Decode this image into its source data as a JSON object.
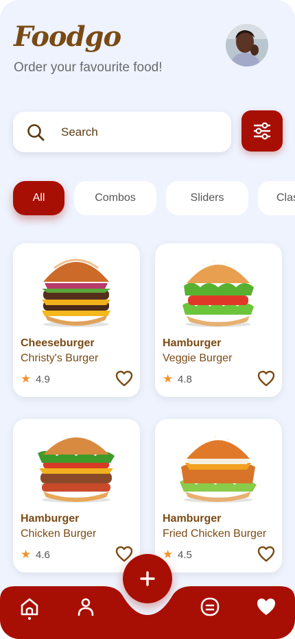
{
  "app": {
    "logo": "Foodgo",
    "subtitle": "Order your favourite food!"
  },
  "search": {
    "placeholder": "Search",
    "icon": "search-icon"
  },
  "filter": {
    "icon": "sliders-icon"
  },
  "categories": [
    {
      "label": "All",
      "active": true
    },
    {
      "label": "Combos",
      "active": false
    },
    {
      "label": "Sliders",
      "active": false
    },
    {
      "label": "Clas",
      "active": false
    }
  ],
  "products": [
    {
      "name": "Cheeseburger",
      "subtitle": "Christy's Burger",
      "rating": "4.9"
    },
    {
      "name": "Hamburger",
      "subtitle": "Veggie Burger",
      "rating": "4.8"
    },
    {
      "name": "Hamburger",
      "subtitle": "Chicken Burger",
      "rating": "4.6"
    },
    {
      "name": "Hamburger",
      "subtitle": "Fried Chicken Burger",
      "rating": "4.5"
    }
  ],
  "nav": {
    "items": [
      "home-icon",
      "profile-icon",
      "chat-icon",
      "favorites-icon"
    ],
    "fab": "add-icon"
  },
  "colors": {
    "brand": "#a80f04",
    "text_brown": "#7a4a14",
    "star": "#f2922a",
    "background": "#eef3fe"
  }
}
